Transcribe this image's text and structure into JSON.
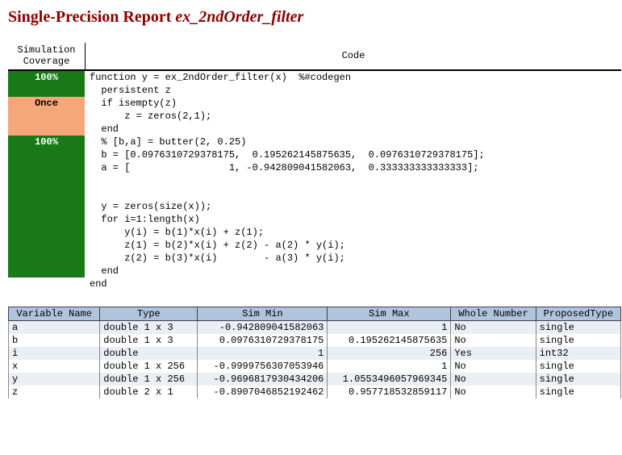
{
  "title_prefix": "Single-Precision Report ",
  "title_fname": "ex_2ndOrder_filter",
  "headers": {
    "coverage": "Simulation\nCoverage",
    "code": "Code"
  },
  "lines": [
    {
      "cov": "100%",
      "cls": "green",
      "code": "function y = ex_2ndOrder_filter(x)  %#codegen"
    },
    {
      "cov": "",
      "cls": "green",
      "code": "  persistent z"
    },
    {
      "cov": "Once",
      "cls": "peach",
      "code": "  if isempty(z)"
    },
    {
      "cov": "",
      "cls": "peach",
      "code": "      z = zeros(2,1);"
    },
    {
      "cov": "",
      "cls": "peach",
      "code": "  end"
    },
    {
      "cov": "100%",
      "cls": "green",
      "code": "  % [b,a] = butter(2, 0.25)"
    },
    {
      "cov": "",
      "cls": "green",
      "code": "  b = [0.0976310729378175,  0.195262145875635,  0.0976310729378175];"
    },
    {
      "cov": "",
      "cls": "green",
      "code": "  a = [                 1, -0.942809041582063,  0.333333333333333];"
    },
    {
      "cov": "",
      "cls": "green",
      "code": ""
    },
    {
      "cov": "",
      "cls": "green",
      "code": ""
    },
    {
      "cov": "",
      "cls": "green",
      "code": "  y = zeros(size(x));"
    },
    {
      "cov": "",
      "cls": "green",
      "code": "  for i=1:length(x)"
    },
    {
      "cov": "",
      "cls": "green",
      "code": "      y(i) = b(1)*x(i) + z(1);"
    },
    {
      "cov": "",
      "cls": "green",
      "code": "      z(1) = b(2)*x(i) + z(2) - a(2) * y(i);"
    },
    {
      "cov": "",
      "cls": "green",
      "code": "      z(2) = b(3)*x(i)        - a(3) * y(i);"
    },
    {
      "cov": "",
      "cls": "green",
      "code": "  end"
    },
    {
      "cov": "",
      "cls": "none",
      "code": "end"
    }
  ],
  "var_headers": [
    "Variable Name",
    "Type",
    "Sim Min",
    "Sim Max",
    "Whole Number",
    "ProposedType"
  ],
  "vars": [
    {
      "name": "a",
      "type": "double 1 x 3",
      "min": "-0.942809041582063",
      "max": "1",
      "wn": "No",
      "pt": "single"
    },
    {
      "name": "b",
      "type": "double 1 x 3",
      "min": "0.0976310729378175",
      "max": "0.195262145875635",
      "wn": "No",
      "pt": "single"
    },
    {
      "name": "i",
      "type": "double",
      "min": "1",
      "max": "256",
      "wn": "Yes",
      "pt": "int32"
    },
    {
      "name": "x",
      "type": "double 1 x 256",
      "min": "-0.9999756307053946",
      "max": "1",
      "wn": "No",
      "pt": "single"
    },
    {
      "name": "y",
      "type": "double 1 x 256",
      "min": "-0.9696817930434206",
      "max": "1.0553496057969345",
      "wn": "No",
      "pt": "single"
    },
    {
      "name": "z",
      "type": "double 2 x 1",
      "min": "-0.8907046852192462",
      "max": "0.957718532859117",
      "wn": "No",
      "pt": "single"
    }
  ]
}
